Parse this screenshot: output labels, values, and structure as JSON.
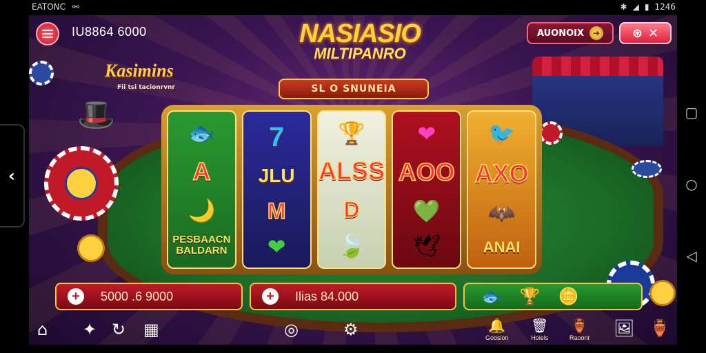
{
  "status_bar": {
    "left_text": "EATONC",
    "left_icon": "link-icon",
    "time": "1246"
  },
  "header": {
    "balance": "IU8864 6000",
    "title_line1": "NASIASIO",
    "title_line2": "MILTIPANRO",
    "banner": "SL O SNUNEIA",
    "announce_label": "AUONOIX",
    "kasino_label": "Kasimins",
    "kasino_sub": "Fii tsi tacionrvnr"
  },
  "reels": {
    "reel1": {
      "mid": "A",
      "bottom": "PESBAACN BALDARN"
    },
    "reel2": {
      "top": "7",
      "mid": "JLU",
      "lower": "M"
    },
    "reel3": {
      "mid": "ALSS",
      "lower": "D"
    },
    "reel4": {
      "mid": "AOO"
    },
    "reel5": {
      "mid": "AXO",
      "bottom": "ANAI"
    }
  },
  "bet_bars": {
    "bar1": "5000 .6 9000",
    "bar2": "Ilias 84.000"
  },
  "bottom_nav": {
    "item1": "Goosion",
    "item2": "Hoiels",
    "item3": "Raoorir"
  },
  "colors": {
    "accent_red": "#c01a28",
    "gold": "#ffd23a",
    "felt": "#1b6a26",
    "bg_purple": "#3b1552"
  }
}
